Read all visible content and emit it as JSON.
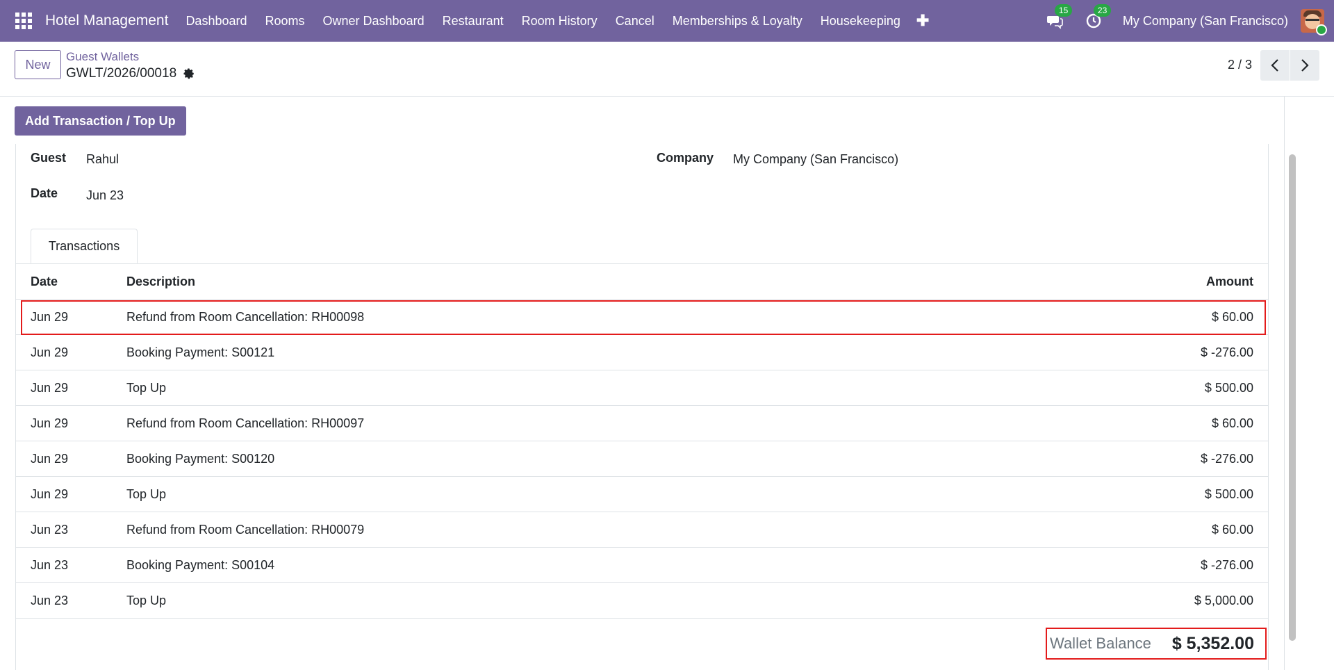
{
  "navbar": {
    "app_title": "Hotel Management",
    "menu": [
      "Dashboard",
      "Rooms",
      "Owner Dashboard",
      "Restaurant",
      "Room History",
      "Cancel",
      "Memberships & Loyalty",
      "Housekeeping"
    ],
    "messages_count": "15",
    "activities_count": "23",
    "company": "My Company (San Francisco)"
  },
  "control": {
    "new_label": "New",
    "breadcrumb_parent": "Guest Wallets",
    "record_name": "GWLT/2026/00018",
    "pager": "2 / 3"
  },
  "actions": {
    "add_transaction": "Add Transaction / Top Up"
  },
  "form": {
    "guest_label": "Guest",
    "guest_value": "Rahul",
    "date_label": "Date",
    "date_value": "Jun 23",
    "company_label": "Company",
    "company_value": "My Company (San Francisco)"
  },
  "tabs": [
    "Transactions"
  ],
  "table": {
    "headers": [
      "Date",
      "Description",
      "Amount"
    ],
    "rows": [
      {
        "date": "Jun 29",
        "description": "Refund from Room Cancellation: RH00098",
        "amount": "$ 60.00"
      },
      {
        "date": "Jun 29",
        "description": "Booking Payment: S00121",
        "amount": "$ -276.00"
      },
      {
        "date": "Jun 29",
        "description": "Top Up",
        "amount": "$ 500.00"
      },
      {
        "date": "Jun 29",
        "description": "Refund from Room Cancellation: RH00097",
        "amount": "$ 60.00"
      },
      {
        "date": "Jun 29",
        "description": "Booking Payment: S00120",
        "amount": "$ -276.00"
      },
      {
        "date": "Jun 29",
        "description": "Top Up",
        "amount": "$ 500.00"
      },
      {
        "date": "Jun 23",
        "description": "Refund from Room Cancellation: RH00079",
        "amount": "$ 60.00"
      },
      {
        "date": "Jun 23",
        "description": "Booking Payment: S00104",
        "amount": "$ -276.00"
      },
      {
        "date": "Jun 23",
        "description": "Top Up",
        "amount": "$ 5,000.00"
      }
    ]
  },
  "balance": {
    "label": "Wallet Balance",
    "value": "$ 5,352.00"
  },
  "colors": {
    "brand": "#71639e",
    "highlight": "#e31b1b",
    "badge": "#28a745"
  }
}
